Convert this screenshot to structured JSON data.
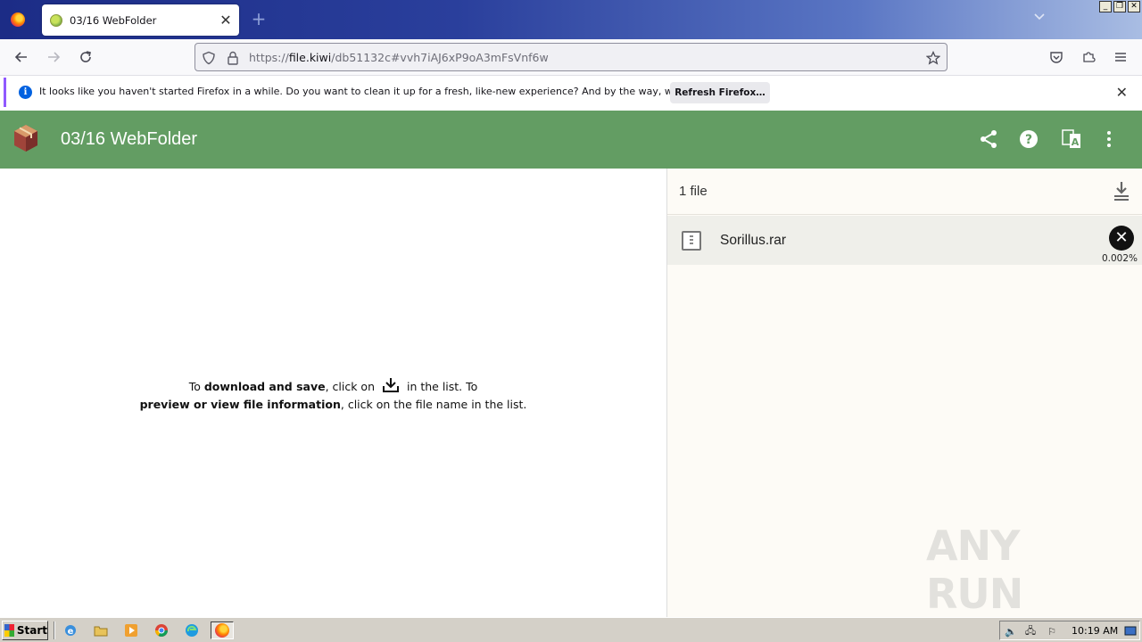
{
  "browser": {
    "tab": {
      "title": "03/16 WebFolder",
      "close": "✕"
    },
    "new_tab": "+",
    "url": {
      "prefix": "https://",
      "host": "file.kiwi",
      "path": "/db51132c#vvh7iAJ6xP9oA3mFsVnf6w"
    },
    "notification": {
      "text": "It looks like you haven't started Firefox in a while. Do you want to clean it up for a fresh, like-new experience? And by the way, welcome back!",
      "button": "Refresh Firefox…",
      "close": "✕"
    }
  },
  "app": {
    "title": "03/16 WebFolder",
    "instructions": {
      "line1_pre": "To ",
      "line1_bold": "download and save",
      "line1_mid": ", click on",
      "line1_post": "in the list. To",
      "line2_bold": "preview or view file information",
      "line2_post": ", click on the file name in the list."
    },
    "files": {
      "count_label": "1 file",
      "items": [
        {
          "name": "Sorillus.rar",
          "progress": "0.002%"
        }
      ]
    }
  },
  "taskbar": {
    "start": "Start",
    "clock": "10:19 AM"
  },
  "watermark": "ANY RUN"
}
